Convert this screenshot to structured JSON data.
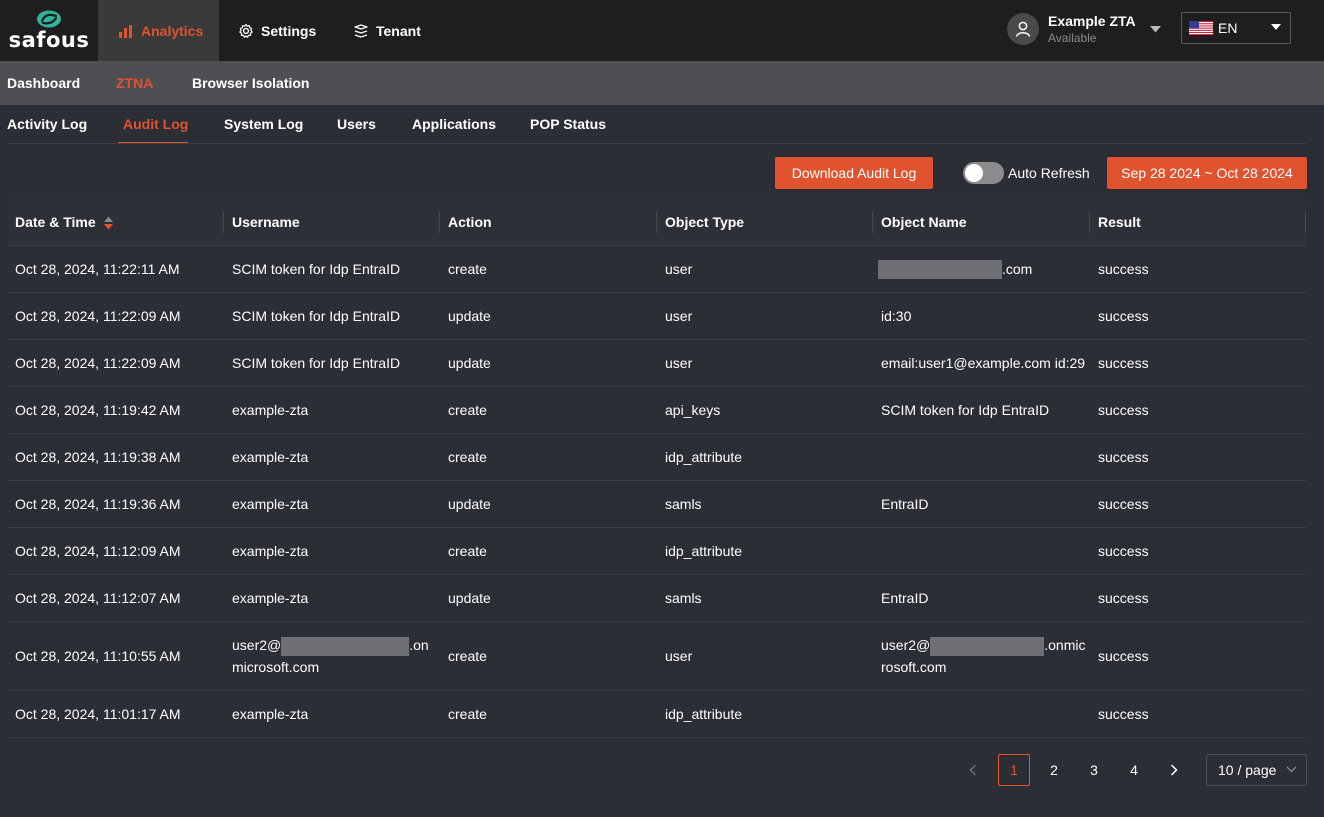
{
  "brand": {
    "logo_text": "safous",
    "accent": "#e0532e",
    "logo_teal": "#2fb39a"
  },
  "top_nav": [
    {
      "label": "Analytics",
      "icon": "bar-chart-icon",
      "active": true
    },
    {
      "label": "Settings",
      "icon": "gear-icon",
      "active": false
    },
    {
      "label": "Tenant",
      "icon": "stack-icon",
      "active": false
    }
  ],
  "user": {
    "name": "Example ZTA",
    "status": "Available"
  },
  "language": {
    "selected": "EN",
    "flag_icon": "us-flag-icon"
  },
  "sub_nav": [
    {
      "label": "Dashboard",
      "active": false
    },
    {
      "label": "ZTNA",
      "active": true
    },
    {
      "label": "Browser Isolation",
      "active": false
    }
  ],
  "tabs": [
    {
      "label": "Activity Log",
      "active": false
    },
    {
      "label": "Audit Log",
      "active": true
    },
    {
      "label": "System Log",
      "active": false
    },
    {
      "label": "Users",
      "active": false
    },
    {
      "label": "Applications",
      "active": false
    },
    {
      "label": "POP Status",
      "active": false
    }
  ],
  "toolbar": {
    "download_label": "Download Audit Log",
    "auto_refresh_label": "Auto Refresh",
    "auto_refresh_on": false,
    "date_range": "Sep 28 2024 ~ Oct 28 2024"
  },
  "table": {
    "columns": [
      "Date & Time",
      "Username",
      "Action",
      "Object Type",
      "Object Name",
      "Result"
    ],
    "rows": [
      {
        "datetime": "Oct 28, 2024, 11:22:11 AM",
        "username": "SCIM token for Idp EntraID",
        "action": "create",
        "object_type": "user",
        "object_name": ".com",
        "result": "success"
      },
      {
        "datetime": "Oct 28, 2024, 11:22:09 AM",
        "username": "SCIM token for Idp EntraID",
        "action": "update",
        "object_type": "user",
        "object_name": "id:30",
        "result": "success"
      },
      {
        "datetime": "Oct 28, 2024, 11:22:09 AM",
        "username": "SCIM token for Idp EntraID",
        "action": "update",
        "object_type": "user",
        "object_name": "email:user1@example.com id:29",
        "result": "success"
      },
      {
        "datetime": "Oct 28, 2024, 11:19:42 AM",
        "username": "example-zta",
        "action": "create",
        "object_type": "api_keys",
        "object_name": "SCIM token for Idp EntraID",
        "result": "success"
      },
      {
        "datetime": "Oct 28, 2024, 11:19:38 AM",
        "username": "example-zta",
        "action": "create",
        "object_type": "idp_attribute",
        "object_name": "",
        "result": "success"
      },
      {
        "datetime": "Oct 28, 2024, 11:19:36 AM",
        "username": "example-zta",
        "action": "update",
        "object_type": "samls",
        "object_name": "EntraID",
        "result": "success"
      },
      {
        "datetime": "Oct 28, 2024, 11:12:09 AM",
        "username": "example-zta",
        "action": "create",
        "object_type": "idp_attribute",
        "object_name": "",
        "result": "success"
      },
      {
        "datetime": "Oct 28, 2024, 11:12:07 AM",
        "username": "example-zta",
        "action": "update",
        "object_type": "samls",
        "object_name": "EntraID",
        "result": "success"
      },
      {
        "datetime": "Oct 28, 2024, 11:10:55 AM",
        "username_prefix": "user2@",
        "username_suffix": ".on",
        "username_line2": "microsoft.com",
        "action": "create",
        "object_type": "user",
        "object_name_prefix": "user2@",
        "object_name_suffix": ".onmic",
        "object_name_line2": "rosoft.com",
        "result": "success"
      },
      {
        "datetime": "Oct 28, 2024, 11:01:17 AM",
        "username": "example-zta",
        "action": "create",
        "object_type": "idp_attribute",
        "object_name": "",
        "result": "success"
      }
    ]
  },
  "pagination": {
    "pages": [
      "1",
      "2",
      "3",
      "4"
    ],
    "current": "1",
    "page_size": "10 / page"
  }
}
